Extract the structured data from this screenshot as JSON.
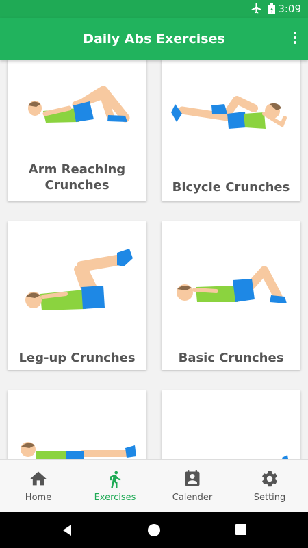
{
  "status_bar": {
    "time": "3:09",
    "icons": [
      "airplane-mode-icon",
      "battery-icon"
    ]
  },
  "app_bar": {
    "title": "Daily Abs Exercises",
    "menu_icon": "more-vert-icon"
  },
  "exercises": [
    {
      "name": "Arm Reaching\nCrunches"
    },
    {
      "name": "Bicycle Crunches"
    },
    {
      "name": "Leg-up Crunches"
    },
    {
      "name": "Basic Crunches"
    },
    {
      "name": ""
    },
    {
      "name": ""
    }
  ],
  "bottom_nav": {
    "items": [
      {
        "label": "Home",
        "icon": "home-icon"
      },
      {
        "label": "Exercises",
        "icon": "walking-person-icon",
        "active": true
      },
      {
        "label": "Calender",
        "icon": "calendar-icon"
      },
      {
        "label": "Setting",
        "icon": "gear-icon"
      }
    ]
  },
  "colors": {
    "primary": "#21b35d",
    "active": "#1faa55",
    "label": "#555555",
    "shirt": "#8bd33f",
    "shorts": "#1e88e5",
    "skin": "#f7c9a0"
  }
}
